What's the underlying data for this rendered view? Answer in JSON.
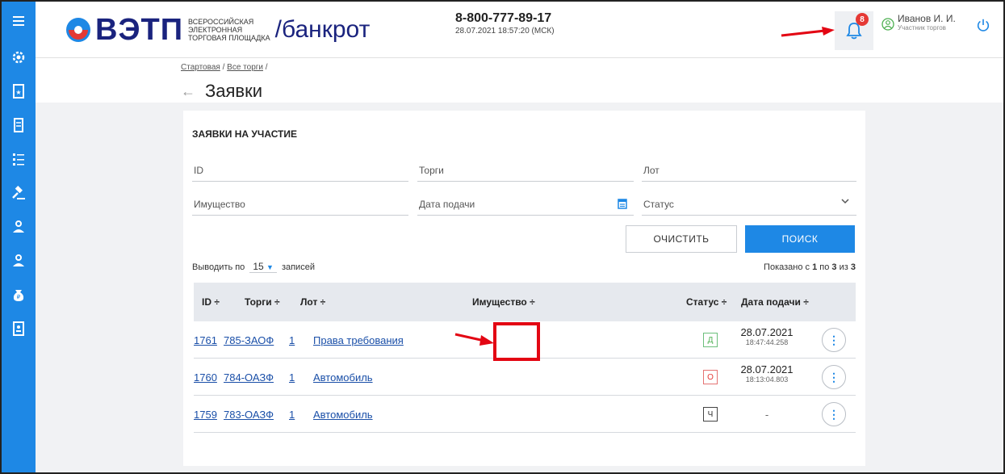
{
  "logo": {
    "name": "ВЭТП",
    "subtitle_line1": "ВСЕРОССИЙСКАЯ",
    "subtitle_line2": "ЭЛЕКТРОННАЯ",
    "subtitle_line3": "ТОРГОВАЯ ПЛОЩАДКА",
    "section": "/банкрот"
  },
  "header": {
    "phone": "8-800-777-89-17",
    "datetime": "28.07.2021 18:57:20 (МСК)",
    "notifications_count": "8",
    "user_name": "Иванов И. И.",
    "user_role": "Участник торгов"
  },
  "breadcrumbs": [
    "Стартовая",
    "Все торги"
  ],
  "page_title": "Заявки",
  "card": {
    "title": "ЗАЯВКИ НА УЧАСТИЕ",
    "filters": {
      "id": "ID",
      "torgi": "Торги",
      "lot": "Лот",
      "property": "Имущество",
      "date": "Дата подачи",
      "status": "Статус"
    },
    "clear_label": "ОЧИСТИТЬ",
    "search_label": "ПОИСК",
    "perpage_prefix": "Выводить по",
    "perpage_value": "15",
    "perpage_suffix": "записей",
    "shown_prefix": "Показано с",
    "shown_from": "1",
    "shown_mid": "по",
    "shown_to": "3",
    "shown_of": "из",
    "shown_total": "3"
  },
  "table": {
    "headers": [
      "ID ÷",
      "Торги ÷",
      "Лот ÷",
      "Имущество ÷",
      "Статус ÷",
      "Дата подачи ÷"
    ],
    "rows": [
      {
        "id": "1761",
        "torgi": "785-ЗАОФ",
        "lot": "1",
        "property": "Права требования",
        "status": "Д",
        "date": "28.07.2021",
        "time": "18:47:44.258"
      },
      {
        "id": "1760",
        "torgi": "784-ОАЗФ",
        "lot": "1",
        "property": "Автомобиль",
        "status": "О",
        "date": "28.07.2021",
        "time": "18:13:04.803"
      },
      {
        "id": "1759",
        "torgi": "783-ОАЗФ",
        "lot": "1",
        "property": "Автомобиль",
        "status": "Ч",
        "date": "-",
        "time": ""
      }
    ]
  },
  "colors": {
    "accent": "#1e88e5",
    "brand": "#1a237e",
    "highlight": "#e30613"
  }
}
